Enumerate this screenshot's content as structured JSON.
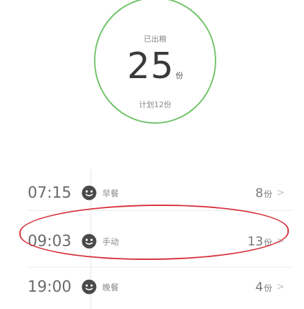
{
  "summary": {
    "top_label": "已出粮",
    "count": "25",
    "unit": "份",
    "plan": "计划12份"
  },
  "schedule": [
    {
      "time": "07:15",
      "label": "早餐",
      "portions": "8",
      "unit": "份",
      "chevron": ">"
    },
    {
      "time": "09:03",
      "label": "手动",
      "portions": "13",
      "unit": "份",
      "chevron": ">"
    },
    {
      "time": "19:00",
      "label": "晚餐",
      "portions": "4",
      "unit": "份",
      "chevron": ">"
    }
  ],
  "icon": "face-icon",
  "colors": {
    "ring": "#73c46b",
    "highlight": "#d6333d"
  }
}
